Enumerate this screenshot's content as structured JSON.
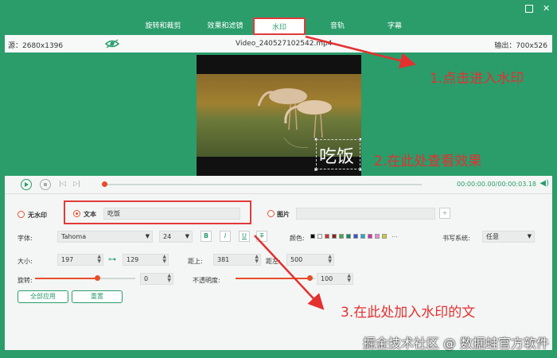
{
  "tabs": [
    "旋转和裁剪",
    "效果和滤镜",
    "水印",
    "音轨",
    "字幕"
  ],
  "infobar": {
    "source": "源：2680x1396",
    "filename": "Video_240527102542.mp4",
    "output": "输出：700x526"
  },
  "preview": {
    "watermark_text": "吃饭"
  },
  "annotations": {
    "a1": "1.点击进入水印",
    "a2": "2.在此处查看效果",
    "a3": "3.在此处加入水印的文"
  },
  "playback": {
    "time": "00:00:00.00/00:00:03.18"
  },
  "watermark": {
    "none_label": "无水印",
    "text_label": "文本",
    "text_value": "吃饭",
    "image_label": "图片"
  },
  "font": {
    "label": "字体:",
    "family": "Tahoma",
    "size": "24",
    "bold": "B",
    "italic": "I",
    "underline": "U",
    "strike": "T",
    "color_label": "颜色:",
    "colors": [
      "#000000",
      "#ffffff",
      "#cc3333",
      "#882222",
      "#44aa44",
      "#118866",
      "#3355cc",
      "#22aacc",
      "#cc33aa",
      "#ee88cc",
      "#cccc33"
    ],
    "writing_label": "书写系统:",
    "writing_value": "任意"
  },
  "size": {
    "label": "大小:",
    "width": "197",
    "height": "129",
    "top_label": "距上:",
    "top": "381",
    "left_label": "距左:",
    "left": "500"
  },
  "rotate": {
    "label": "旋转:",
    "value": "0"
  },
  "opacity": {
    "label": "不透明度:",
    "value": "100"
  },
  "buttons": {
    "apply_all": "全部应用",
    "reset": "重置"
  },
  "site_watermark": "掘金技术社区 @ 数据蛙官方软件"
}
